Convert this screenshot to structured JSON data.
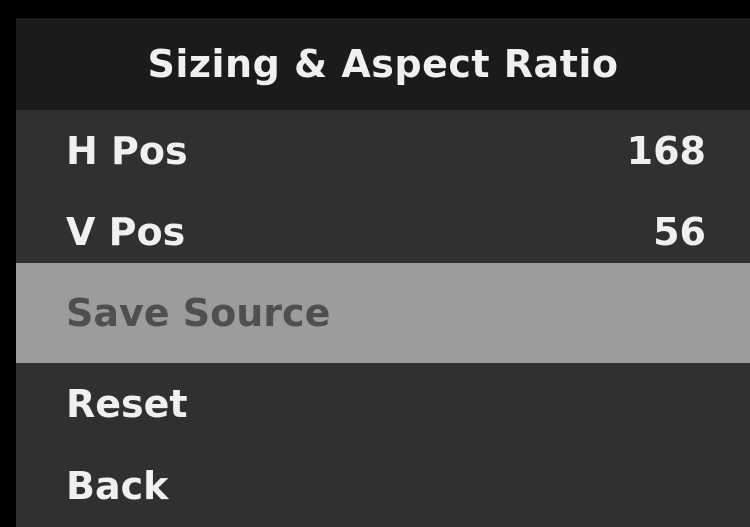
{
  "menu": {
    "title": "Sizing & Aspect Ratio",
    "items": [
      {
        "label": "H Pos",
        "value": "168"
      },
      {
        "label": "V Pos",
        "value": "56"
      },
      {
        "label": "Save Source",
        "value": ""
      },
      {
        "label": "Reset",
        "value": ""
      },
      {
        "label": "Back",
        "value": ""
      }
    ],
    "selected_item": "Save Source"
  },
  "colors": {
    "header_bg": "#1b1b1b",
    "panel_bg": "#303030",
    "selected_bg": "#9c9c9c",
    "selected_text": "#4f4f4f",
    "text": "#f0f0f0"
  }
}
